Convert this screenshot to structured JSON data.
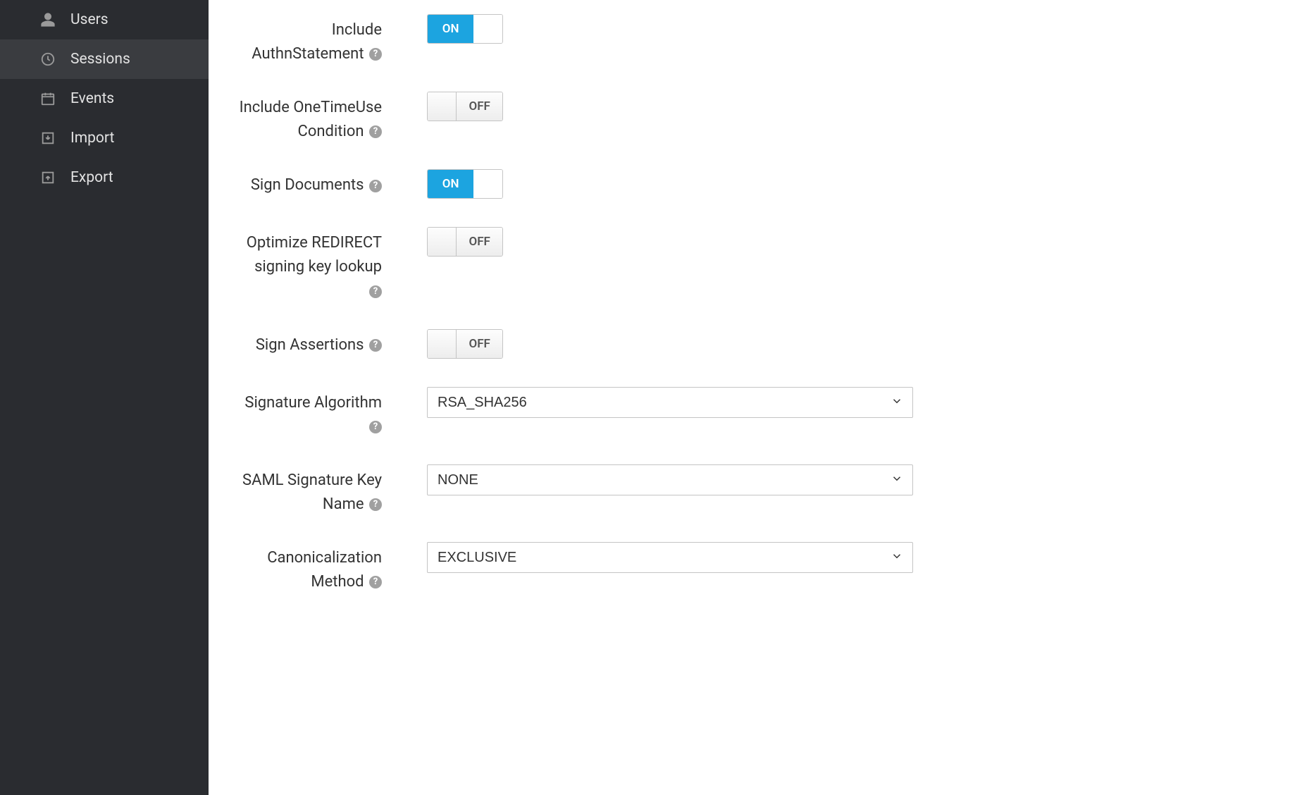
{
  "sidebar": {
    "items": [
      {
        "id": "users",
        "label": "Users",
        "icon": "user-icon",
        "active": false
      },
      {
        "id": "sessions",
        "label": "Sessions",
        "icon": "clock-icon",
        "active": true
      },
      {
        "id": "events",
        "label": "Events",
        "icon": "calendar-icon",
        "active": false
      },
      {
        "id": "import",
        "label": "Import",
        "icon": "import-icon",
        "active": false
      },
      {
        "id": "export",
        "label": "Export",
        "icon": "export-icon",
        "active": false
      }
    ]
  },
  "toggle_labels": {
    "on": "ON",
    "off": "OFF"
  },
  "form": {
    "include_authn_statement": {
      "label": "Include AuthnStatement",
      "value": true
    },
    "include_onetimeuse": {
      "label": "Include OneTimeUse Condition",
      "value": false
    },
    "sign_documents": {
      "label": "Sign Documents",
      "value": true
    },
    "optimize_redirect": {
      "label": "Optimize REDIRECT signing key lookup",
      "value": false
    },
    "sign_assertions": {
      "label": "Sign Assertions",
      "value": false
    },
    "signature_algorithm": {
      "label": "Signature Algorithm",
      "value": "RSA_SHA256"
    },
    "saml_signature_key_name": {
      "label": "SAML Signature Key Name",
      "value": "NONE"
    },
    "canonicalization_method": {
      "label": "Canonicalization Method",
      "value": "EXCLUSIVE"
    }
  }
}
